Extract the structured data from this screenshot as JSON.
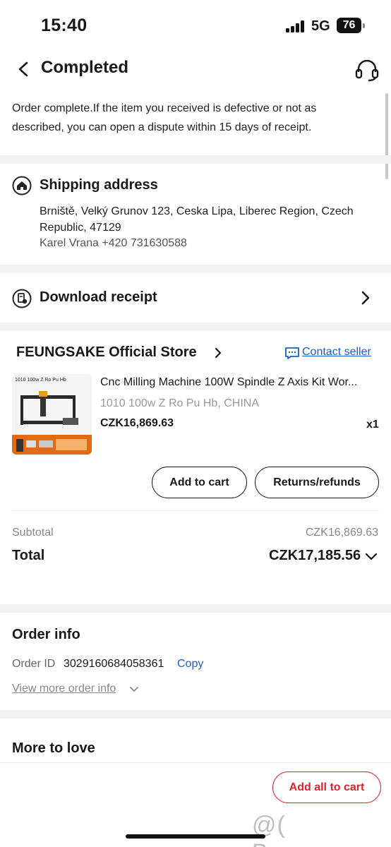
{
  "status_bar": {
    "time": "15:40",
    "network": "5G",
    "battery": "76"
  },
  "header": {
    "title": "Completed",
    "back_icon": "chevron-left-icon",
    "support_icon": "headset-icon"
  },
  "notice": {
    "text": "Order complete.If the item you received is defective or not as described, you can open a dispute within 15 days of receipt."
  },
  "shipping": {
    "title": "Shipping address",
    "icon": "home-icon",
    "address": "Brniště, Velký Grunov 123, Ceska Lipa, Liberec Region, Czech Republic, 47129",
    "contact": "Karel Vrana +420 731630588"
  },
  "receipt": {
    "label": "Download receipt",
    "icon": "receipt-icon"
  },
  "store": {
    "name": "FEUNGSAKE Official Store",
    "contact_label": "Contact seller",
    "product": {
      "title": "Cnc Milling Machine 100W Spindle Z Axis Kit Wor...",
      "variant": "1010 100w Z Ro Pu Hb, CHINA",
      "price": "CZK16,869.63",
      "quantity": "x1",
      "image_caption": "1010 100w Z Ro Pu Hb"
    },
    "add_to_cart_label": "Add to cart",
    "returns_label": "Returns/refunds"
  },
  "summary": {
    "subtotal_label": "Subtotal",
    "subtotal_value": "CZK16,869.63",
    "total_label": "Total",
    "total_value": "CZK17,185.56"
  },
  "order_info": {
    "title": "Order info",
    "order_id_label": "Order ID",
    "order_id_value": "3029160684058361",
    "copy_label": "Copy",
    "view_more_label": "View more order info"
  },
  "more_to_love": {
    "title": "More to love"
  },
  "bottom": {
    "add_all_label": "Add all to cart"
  },
  "watermark": "@( Bazos.cz",
  "colors": {
    "accent_red": "#e0202b",
    "link_blue": "#1a5fcf",
    "divider": "#f2f2f2"
  }
}
